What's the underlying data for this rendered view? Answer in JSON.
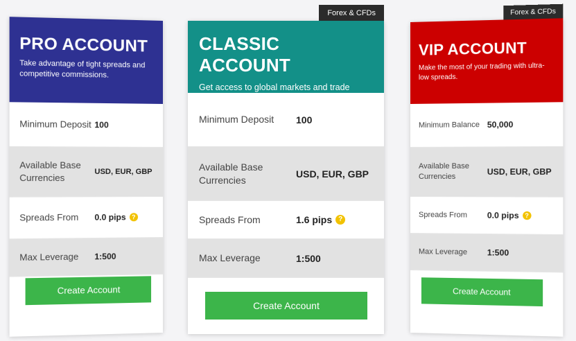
{
  "tag_label": "Forex & CFDs",
  "button_label": "Create Account",
  "colors": {
    "pro": "#2e3192",
    "classic": "#139088",
    "vip": "#cc0000",
    "button": "#3cb54a",
    "help": "#f2c200"
  },
  "icons": {
    "help": "question-icon"
  },
  "pro": {
    "title": "PRO ACCOUNT",
    "desc": "Take advantage of tight spreads and competitive commissions.",
    "rows": [
      {
        "label": "Minimum Deposit",
        "value": "100"
      },
      {
        "label": "Available Base Currencies",
        "value": "USD, EUR, GBP"
      },
      {
        "label": "Spreads From",
        "value": "0.0 pips"
      },
      {
        "label": "Max Leverage",
        "value": "1:500"
      }
    ]
  },
  "classic": {
    "title": "CLASSIC ACCOUNT",
    "desc": "Get access to global markets and trade commission-free.",
    "rows": [
      {
        "label": "Minimum Deposit",
        "value": "100"
      },
      {
        "label": "Available Base Currencies",
        "value": "USD, EUR, GBP"
      },
      {
        "label": "Spreads From",
        "value": "1.6 pips"
      },
      {
        "label": "Max Leverage",
        "value": "1:500"
      }
    ]
  },
  "vip": {
    "title": "VIP ACCOUNT",
    "desc": "Make the most of your trading with ultra-low spreads.",
    "rows": [
      {
        "label": "Minimum Balance",
        "value": "50,000"
      },
      {
        "label": "Available Base Currencies",
        "value": "USD, EUR, GBP"
      },
      {
        "label": "Spreads From",
        "value": "0.0 pips"
      },
      {
        "label": "Max Leverage",
        "value": "1:500"
      }
    ]
  }
}
